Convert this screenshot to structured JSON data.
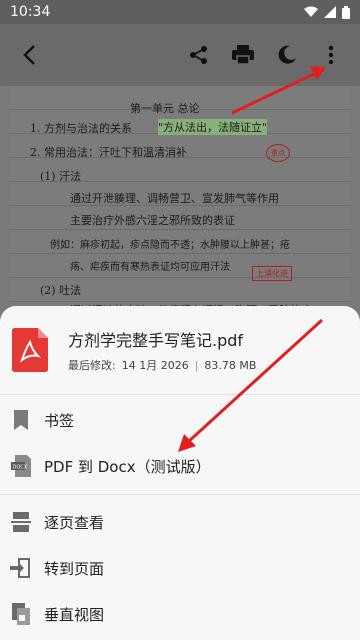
{
  "status": {
    "time": "10:34"
  },
  "document": {
    "heading": "第一单元   总论",
    "lines": [
      "1. 方剂与治法的关系",
      "\"方从法出，法随证立\"",
      "2. 常用治法：汗吐下和温清消补",
      "(1) 汗法",
      "通过开泄腠理、调畅营卫、宣发肺气等作用",
      "主要治疗外感六淫之邪所致的表证",
      "例如：麻疹初起，疹点隐而不透；水肿腰以上肿甚；疮",
      "疡、疟疾而有寒热表证均可应用汗法",
      "(2) 吐法",
      "通过涌吐的方法，使停留在咽喉、胸膈、胃脘的痰"
    ],
    "stamp": "重点",
    "tag": "上涌化逆"
  },
  "file": {
    "name": "方剂学完整手写笔记.pdf",
    "modified_label": "最后修改:",
    "modified_date": "14 1月 2026",
    "size": "83.78 MB"
  },
  "menu": [
    {
      "label": "书签",
      "icon": "bookmark-icon"
    },
    {
      "label": "PDF 到 Docx（测试版）",
      "icon": "docx-icon"
    },
    {
      "label": "逐页查看",
      "icon": "page-view-icon"
    },
    {
      "label": "转到页面",
      "icon": "goto-page-icon"
    },
    {
      "label": "垂直视图",
      "icon": "vertical-view-icon"
    }
  ],
  "colors": {
    "accent": "#e02020",
    "pdf_red": "#e53935",
    "sheet_bg": "#f7f7f7"
  }
}
